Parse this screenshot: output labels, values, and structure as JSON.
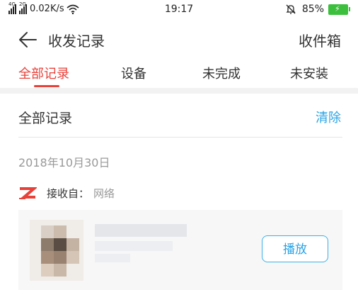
{
  "status_bar": {
    "signal1_label": "4G",
    "signal2_label": "2G",
    "speed": "0.02K/s",
    "time": "19:17",
    "battery": "85%",
    "icons": [
      "signal-icon",
      "signal-icon",
      "wifi-icon",
      "bell-muted-icon",
      "battery-icon"
    ]
  },
  "header": {
    "title": "收发记录",
    "right_action": "收件箱"
  },
  "tabs": [
    {
      "label": "全部记录",
      "active": true
    },
    {
      "label": "设备",
      "active": false
    },
    {
      "label": "未完成",
      "active": false
    },
    {
      "label": "未安装",
      "active": false
    }
  ],
  "section": {
    "title": "全部记录",
    "clear": "清除"
  },
  "record": {
    "date": "2018年10月30日",
    "source_label": "接收自：",
    "source_value": "网络",
    "play": "播放"
  },
  "colors": {
    "accent_red": "#e8413a",
    "accent_blue": "#2aa3e6",
    "battery_green": "#3cbf3c"
  }
}
